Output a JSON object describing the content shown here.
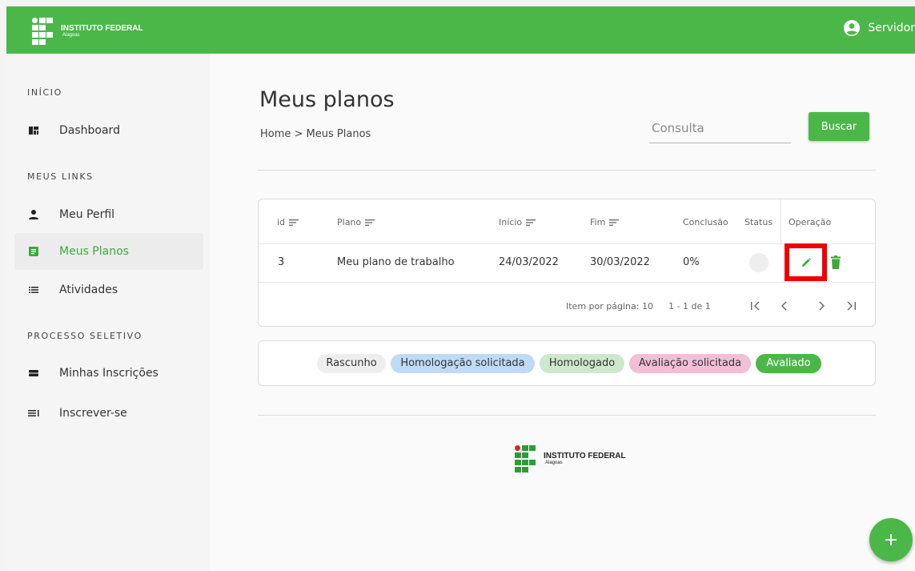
{
  "header": {
    "logo_title": "INSTITUTO FEDERAL",
    "logo_subtitle": "Alagoas",
    "user_label": "Servidor"
  },
  "sidebar": {
    "section_inicio": "INÍCIO",
    "dashboard": "Dashboard",
    "section_links": "MEUS LINKS",
    "meu_perfil": "Meu Perfil",
    "meus_planos": "Meus Planos",
    "atividades": "Atividades",
    "section_processo": "PROCESSO SELETIVO",
    "minhas_inscricoes": "Minhas Inscrições",
    "inscrever_se": "Inscrever-se"
  },
  "main": {
    "title": "Meus planos",
    "breadcrumb": "Home > Meus Planos",
    "search_placeholder": "Consulta",
    "search_button": "Buscar"
  },
  "table": {
    "headers": {
      "id": "id",
      "plano": "Plano",
      "inicio": "Início",
      "fim": "Fim",
      "conclusao": "Conclusão",
      "status": "Status",
      "operacao": "Operação"
    },
    "rows": [
      {
        "id": "3",
        "plano": "Meu plano de trabalho",
        "inicio": "24/03/2022",
        "fim": "30/03/2022",
        "conclusao": "0%"
      }
    ],
    "items_per_page": "Item por página: 10",
    "range": "1 - 1 de 1"
  },
  "legend": [
    {
      "label": "Rascunho",
      "color": "#eeeeee"
    },
    {
      "label": "Homologação solicitada",
      "color": "#bfdaf5"
    },
    {
      "label": "Homologado",
      "color": "#cde8cd"
    },
    {
      "label": "Avaliação solicitada",
      "color": "#f2bfd6"
    },
    {
      "label": "Avaliado",
      "color": "#4cb749"
    }
  ],
  "footer": {
    "logo_title": "INSTITUTO FEDERAL",
    "logo_subtitle": "Alagoas"
  },
  "colors": {
    "brand_green": "#4cb749",
    "highlight_red": "#f00000"
  },
  "icons": {
    "user": "account-circle-icon",
    "dashboard": "dashboard-icon",
    "profile": "person-icon",
    "plans": "document-icon",
    "activities": "list-icon",
    "subscriptions": "inbox-icon",
    "subscribe": "playlist-icon",
    "edit": "pencil-icon",
    "delete": "trash-icon",
    "add": "plus-icon"
  }
}
